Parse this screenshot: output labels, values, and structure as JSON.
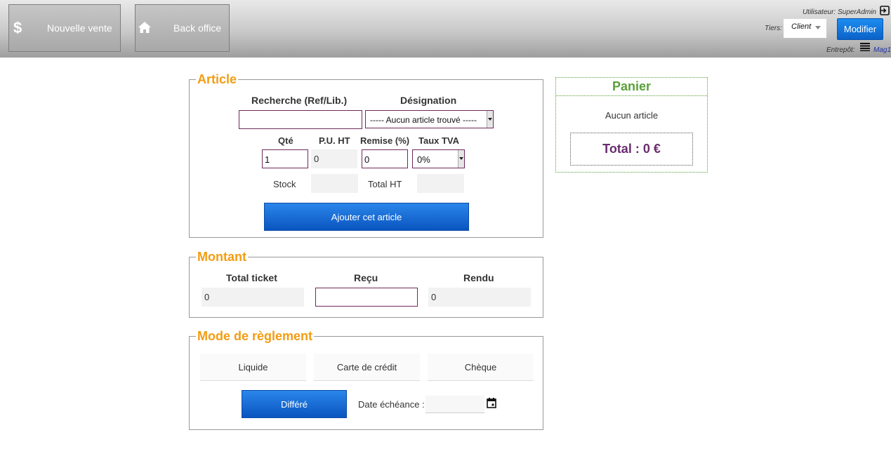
{
  "topbar": {
    "nouvelle_vente": {
      "icon": "dollar-icon",
      "glyph": "$",
      "label": "Nouvelle vente"
    },
    "back_office": {
      "icon": "home-icon",
      "label": "Back office"
    },
    "user": {
      "label": "Utilisateur:",
      "value": "SuperAdmin"
    },
    "tiers": {
      "label": "Tiers:",
      "value": "Client"
    },
    "modifier_label": "Modifier",
    "entrepot": {
      "label": "Entrepôt:",
      "value": "Mag1"
    }
  },
  "article": {
    "legend": "Article",
    "recherche_label": "Recherche (Ref/Lib.)",
    "recherche_value": "",
    "designation_label": "Désignation",
    "designation_value": "----- Aucun article trouvé -----",
    "qte_label": "Qté",
    "qte_value": "1",
    "pu_label": "P.U. HT",
    "pu_value": "0",
    "remise_label": "Remise (%)",
    "remise_value": "0",
    "tva_label": "Taux TVA",
    "tva_value": "0%",
    "stock_label": "Stock",
    "stock_value": "",
    "total_ht_label": "Total HT",
    "total_ht_value": "",
    "add_label": "Ajouter cet article"
  },
  "montant": {
    "legend": "Montant",
    "total_ticket_label": "Total ticket",
    "total_ticket_value": "0",
    "recu_label": "Reçu",
    "recu_value": "",
    "rendu_label": "Rendu",
    "rendu_value": "0"
  },
  "reglement": {
    "legend": "Mode de règlement",
    "options": [
      "Liquide",
      "Carte de crédit",
      "Chèque"
    ],
    "differe_label": "Différé",
    "date_label": "Date échéance :",
    "date_value": ""
  },
  "panier": {
    "title": "Panier",
    "empty_text": "Aucun article",
    "total_text": "Total : 0 €"
  },
  "colors": {
    "legend_orange": "#f39c12",
    "panier_green": "#5aa03a",
    "total_purple": "#6a2d6e",
    "button_blue": "#0b62c8"
  }
}
